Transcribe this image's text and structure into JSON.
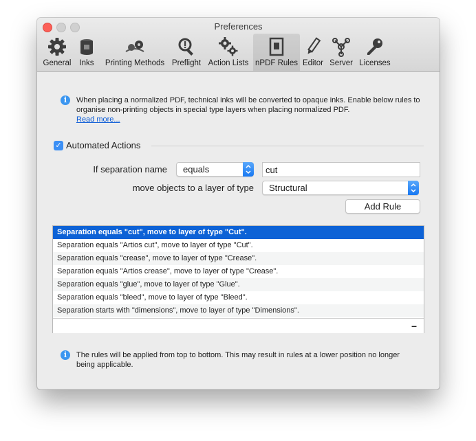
{
  "window": {
    "title": "Preferences"
  },
  "toolbar": {
    "tabs": [
      {
        "label": "General",
        "icon": "gear-icon"
      },
      {
        "label": "Inks",
        "icon": "ink-can-icon"
      },
      {
        "label": "Printing Methods",
        "icon": "printing-methods-icon"
      },
      {
        "label": "Preflight",
        "icon": "preflight-magnifier-icon"
      },
      {
        "label": "Action Lists",
        "icon": "action-lists-gears-icon"
      },
      {
        "label": "nPDF Rules",
        "icon": "npdf-rules-icon",
        "selected": true
      },
      {
        "label": "Editor",
        "icon": "pencil-icon"
      },
      {
        "label": "Server",
        "icon": "server-network-icon"
      },
      {
        "label": "Licenses",
        "icon": "key-icon"
      }
    ]
  },
  "info_top": {
    "text": "When placing a normalized PDF, technical inks will be converted to opaque inks. Enable below rules to organise non-printing objects in special type layers when placing normalized PDF.",
    "link": "Read more..."
  },
  "automated_actions": {
    "label": "Automated Actions",
    "checked": true
  },
  "rule_form": {
    "separation_label": "If separation name",
    "operator_value": "equals",
    "name_value": "cut",
    "move_label": "move objects to a layer of type",
    "layer_type_value": "Structural",
    "add_rule_label": "Add Rule"
  },
  "rules": [
    "Separation equals \"cut\", move to layer of type \"Cut\".",
    "Separation equals \"Artios cut\", move to layer of type \"Cut\".",
    "Separation equals \"crease\", move to layer of type \"Crease\".",
    "Separation equals \"Artios crease\", move to layer of type \"Crease\".",
    "Separation equals \"glue\", move to layer of type \"Glue\".",
    "Separation equals \"bleed\", move to layer of type \"Bleed\".",
    "Separation starts with \"dimensions\", move to layer of type \"Dimensions\"."
  ],
  "selected_rule_index": 0,
  "table_footer": {
    "remove_label": "–"
  },
  "info_bottom": {
    "text": "The rules will be applied from top to bottom. This may result in rules at a lower position no longer being applicable."
  },
  "colors": {
    "accent": "#0d62d6",
    "close_button": "#fc5f57",
    "info_icon": "#3b96f0"
  }
}
